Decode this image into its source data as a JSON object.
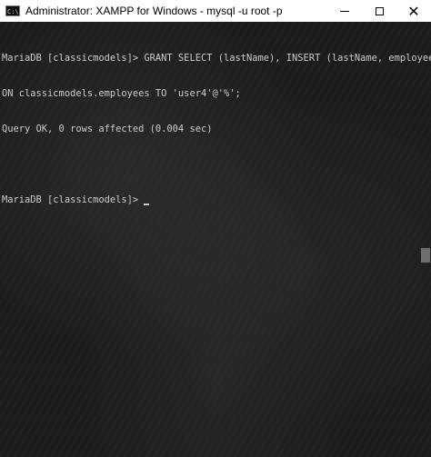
{
  "window": {
    "title": "Administrator: XAMPP for Windows - mysql  -u root -p",
    "app_icon_text": "C:\\",
    "controls": {
      "minimize": "minimize-icon",
      "maximize": "maximize-icon",
      "close": "✕"
    }
  },
  "console": {
    "lines": [
      "MariaDB [classicmodels]> GRANT SELECT (lastName), INSERT (lastName, employeeNumber)",
      "ON classicmodels.employees TO 'user4'@'%';",
      "Query OK, 0 rows affected (0.004 sec)",
      "",
      "MariaDB [classicmodels]>"
    ]
  },
  "colors": {
    "titlebar_bg": "#ffffff",
    "console_bg": "#1c1c1c",
    "console_text": "#cccccc"
  }
}
